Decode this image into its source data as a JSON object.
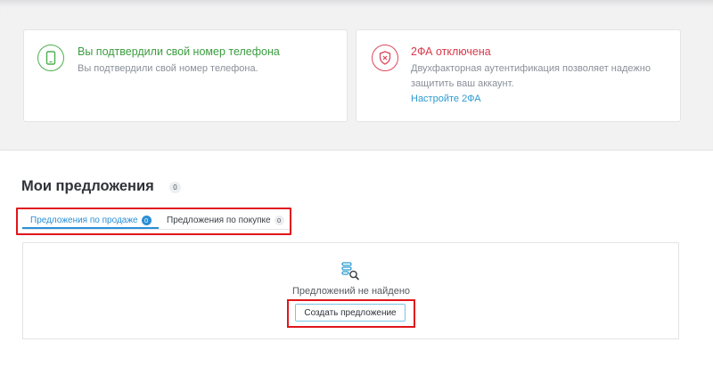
{
  "verification": {
    "phone_card": {
      "title": "Вы подтвердили свой номер телефона",
      "text": "Вы подтвердили свой номер телефона."
    },
    "twofa_card": {
      "title": "2ФА отключена",
      "text": "Двухфакторная аутентификация позволяет надежно защитить ваш аккаунт.",
      "link": "Настройте 2ФА"
    }
  },
  "offers": {
    "title": "Мои предложения",
    "count": "0",
    "tabs": [
      {
        "label": "Предложения по продаже",
        "count": "0",
        "active": true
      },
      {
        "label": "Предложения по покупке",
        "count": "0",
        "active": false
      }
    ],
    "empty_text": "Предложений не найдено",
    "create_button": "Создать предложение"
  },
  "colors": {
    "success": "#3c9c40",
    "danger": "#d83a4c",
    "accent": "#2b8fd6",
    "highlight": "#e0161b"
  },
  "icons": {
    "phone_card": "phone-icon",
    "twofa_card": "shield-x-icon",
    "empty_state": "list-search-icon"
  }
}
